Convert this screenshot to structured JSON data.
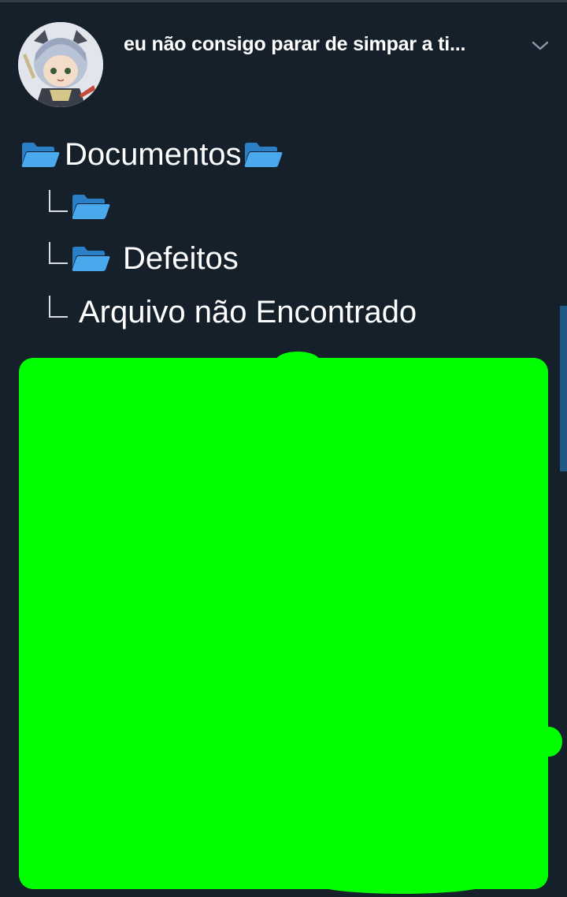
{
  "tweet": {
    "text_line": "eu não consigo parar de simpar a ti..."
  },
  "tree": {
    "root_label": "Documentos",
    "child_1_label": "",
    "child_2_label": "Defeitos",
    "child_3_label": "Arquivo não Encontrado"
  },
  "colors": {
    "background": "#15202b",
    "folder_blue": "#3c9be0",
    "redaction_green": "#00ff00",
    "scrollbar": "#1d5a86"
  },
  "icons": {
    "folder": "open-folder-icon",
    "chevron": "chevron-down-icon",
    "branch": "tree-branch-icon"
  }
}
